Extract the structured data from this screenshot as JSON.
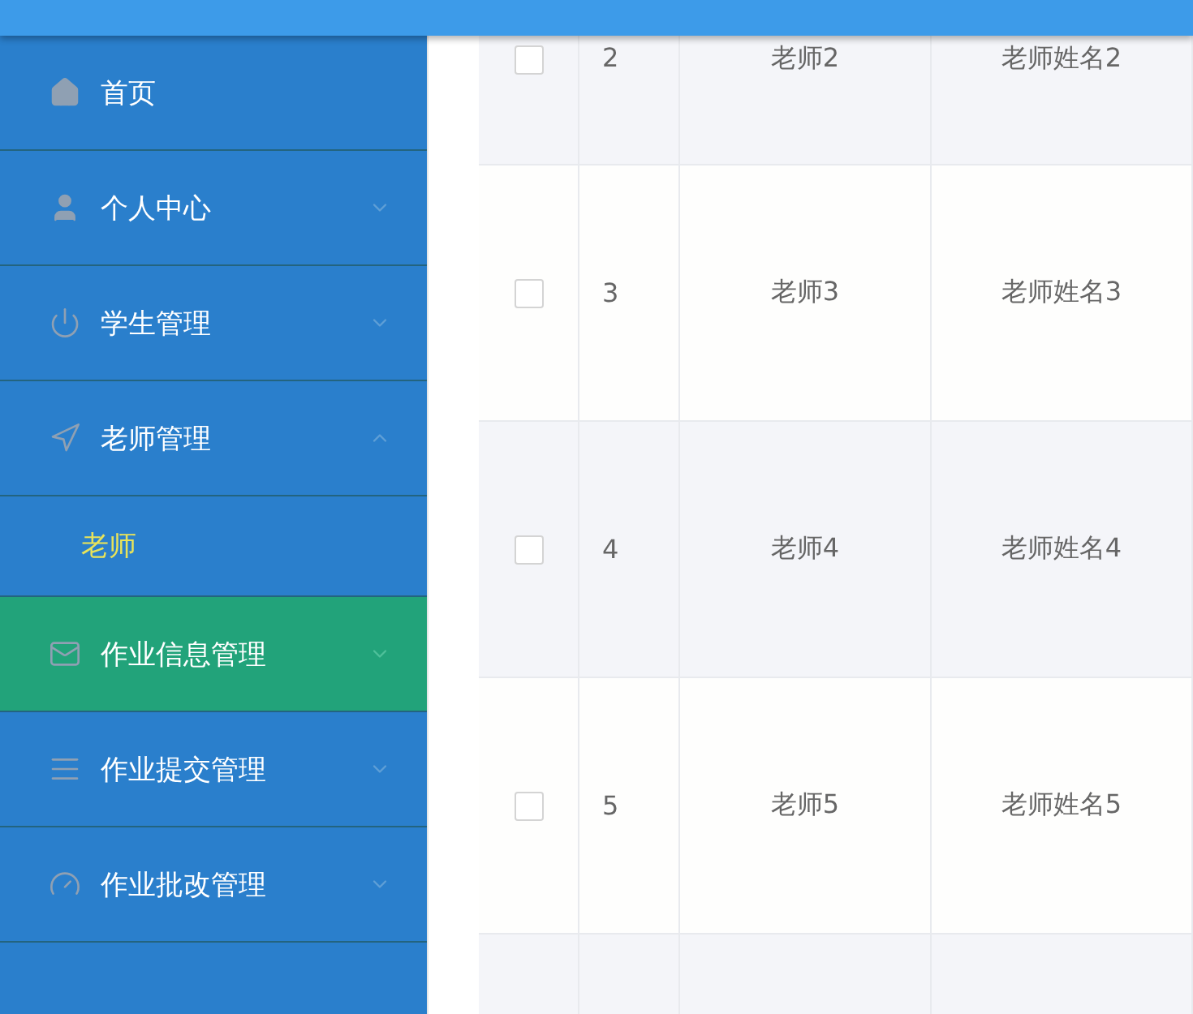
{
  "sidebar": {
    "items": [
      {
        "kind": "link",
        "label": "首页",
        "selected": false
      },
      {
        "kind": "group",
        "label": "个人中心",
        "expanded": false,
        "selected": false
      },
      {
        "kind": "group",
        "label": "学生管理",
        "expanded": false,
        "selected": false
      },
      {
        "kind": "group",
        "label": "老师管理",
        "expanded": true,
        "selected": false,
        "children": [
          {
            "label": "老师",
            "selected": true
          }
        ]
      },
      {
        "kind": "group",
        "label": "作业信息管理",
        "expanded": false,
        "selected": true
      },
      {
        "kind": "group",
        "label": "作业提交管理",
        "expanded": false,
        "selected": false
      },
      {
        "kind": "group",
        "label": "作业批改管理",
        "expanded": false,
        "selected": false
      }
    ]
  },
  "table": {
    "rows": [
      {
        "checked": false,
        "cells": [
          "2",
          "老师2",
          "老师姓名2"
        ]
      },
      {
        "checked": false,
        "cells": [
          "3",
          "老师3",
          "老师姓名3"
        ]
      },
      {
        "checked": false,
        "cells": [
          "4",
          "老师4",
          "老师姓名4"
        ]
      },
      {
        "checked": false,
        "cells": [
          "5",
          "老师5",
          "老师姓名5"
        ]
      }
    ]
  }
}
